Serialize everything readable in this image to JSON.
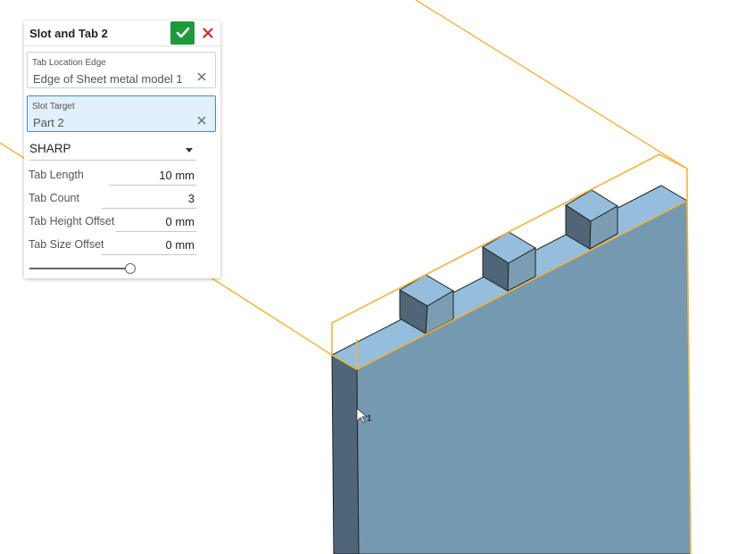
{
  "dialog": {
    "title": "Slot and Tab 2",
    "accept_icon": "checkmark-icon",
    "cancel_icon": "close-icon",
    "tab_location_edge": {
      "label": "Tab Location Edge",
      "value": "Edge of Sheet metal model 1"
    },
    "slot_target": {
      "label": "Slot Target",
      "value": "Part 2"
    },
    "corner_style": {
      "value": "SHARP"
    },
    "params": [
      {
        "label": "Tab Length",
        "value": "10 mm"
      },
      {
        "label": "Tab Count",
        "value": "3"
      },
      {
        "label": "Tab Height Offset",
        "value": "0 mm"
      },
      {
        "label": "Tab Size Offset",
        "value": "0 mm"
      }
    ],
    "slider": {
      "level": 1.0
    }
  },
  "viewport": {
    "cursor_badge": "1",
    "colors": {
      "highlight": "#f3b339",
      "face_front": "#7599b0",
      "face_side": "#4e6677",
      "face_top": "#94bedb",
      "tab_dark": "#4e6677",
      "tab_light": "#7b9db3"
    }
  }
}
